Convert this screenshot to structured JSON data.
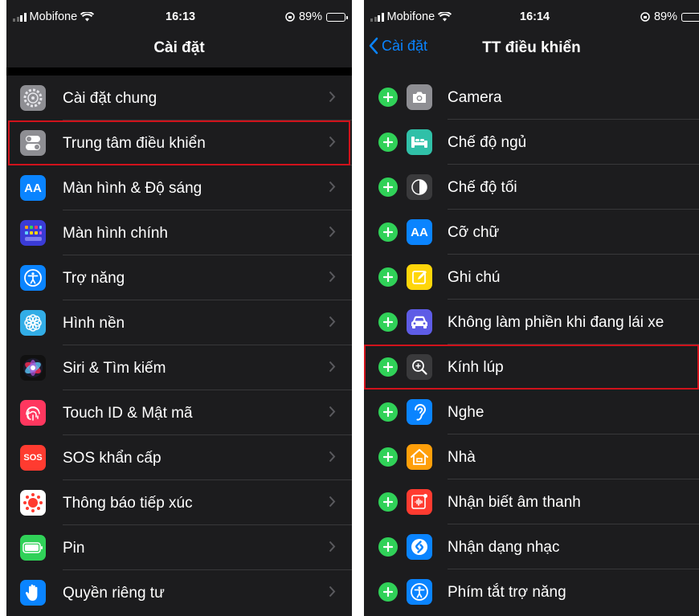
{
  "left": {
    "status": {
      "carrier": "Mobifone",
      "time": "16:13",
      "battery": "89%"
    },
    "title": "Cài đặt",
    "items": [
      {
        "label": "Cài đặt chung",
        "icon": "gear-icon",
        "color": "#8e8e93"
      },
      {
        "label": "Trung tâm điều khiển",
        "icon": "toggles-icon",
        "color": "#8e8e93"
      },
      {
        "label": "Màn hình & Độ sáng",
        "icon": "text-size-icon",
        "color": "#0a84ff",
        "icon_text": "AA"
      },
      {
        "label": "Màn hình chính",
        "icon": "home-screen-grid-icon",
        "color": "#3a3bd6"
      },
      {
        "label": "Trợ năng",
        "icon": "accessibility-icon",
        "color": "#0a84ff"
      },
      {
        "label": "Hình nền",
        "icon": "wallpaper-flower-icon",
        "color": "#32ade6"
      },
      {
        "label": "Siri & Tìm kiếm",
        "icon": "siri-icon",
        "color": "#1c1c2e"
      },
      {
        "label": "Touch ID & Mật mã",
        "icon": "fingerprint-icon",
        "color": "#ff375f"
      },
      {
        "label": "SOS khẩn cấp",
        "icon": "sos-icon",
        "color": "#ff3b30",
        "icon_text": "SOS"
      },
      {
        "label": "Thông báo tiếp xúc",
        "icon": "exposure-notification-icon",
        "color": "#ffffff"
      },
      {
        "label": "Pin",
        "icon": "battery-icon",
        "color": "#30d158"
      },
      {
        "label": "Quyền riêng tư",
        "icon": "hand-icon",
        "color": "#0a84ff"
      }
    ],
    "highlighted_index": 1
  },
  "right": {
    "status": {
      "carrier": "Mobifone",
      "time": "16:14",
      "battery": "89%"
    },
    "back_label": "Cài đặt",
    "title": "TT điều khiển",
    "items": [
      {
        "label": "Camera",
        "icon": "camera-icon",
        "color": "#8e8e93"
      },
      {
        "label": "Chế độ ngủ",
        "icon": "bed-icon",
        "color": "#30c0a8"
      },
      {
        "label": "Chế độ tối",
        "icon": "dark-mode-icon",
        "color": "#3a3a3c"
      },
      {
        "label": "Cỡ chữ",
        "icon": "text-size-icon",
        "color": "#0a84ff",
        "icon_text": "AA"
      },
      {
        "label": "Ghi chú",
        "icon": "notes-icon",
        "color": "#ffd60a"
      },
      {
        "label": "Không làm phiền khi đang lái xe",
        "icon": "car-icon",
        "color": "#5e5ce6"
      },
      {
        "label": "Kính lúp",
        "icon": "magnifier-icon",
        "color": "#3a3a3c"
      },
      {
        "label": "Nghe",
        "icon": "ear-icon",
        "color": "#0a84ff"
      },
      {
        "label": "Nhà",
        "icon": "home-icon",
        "color": "#ff9f0a"
      },
      {
        "label": "Nhận biết âm thanh",
        "icon": "sound-recognition-icon",
        "color": "#ff3b30"
      },
      {
        "label": "Nhận dạng nhạc",
        "icon": "shazam-icon",
        "color": "#0a84ff"
      },
      {
        "label": "Phím tắt trợ năng",
        "icon": "accessibility-icon",
        "color": "#0a84ff"
      }
    ],
    "highlighted_index": 6
  }
}
